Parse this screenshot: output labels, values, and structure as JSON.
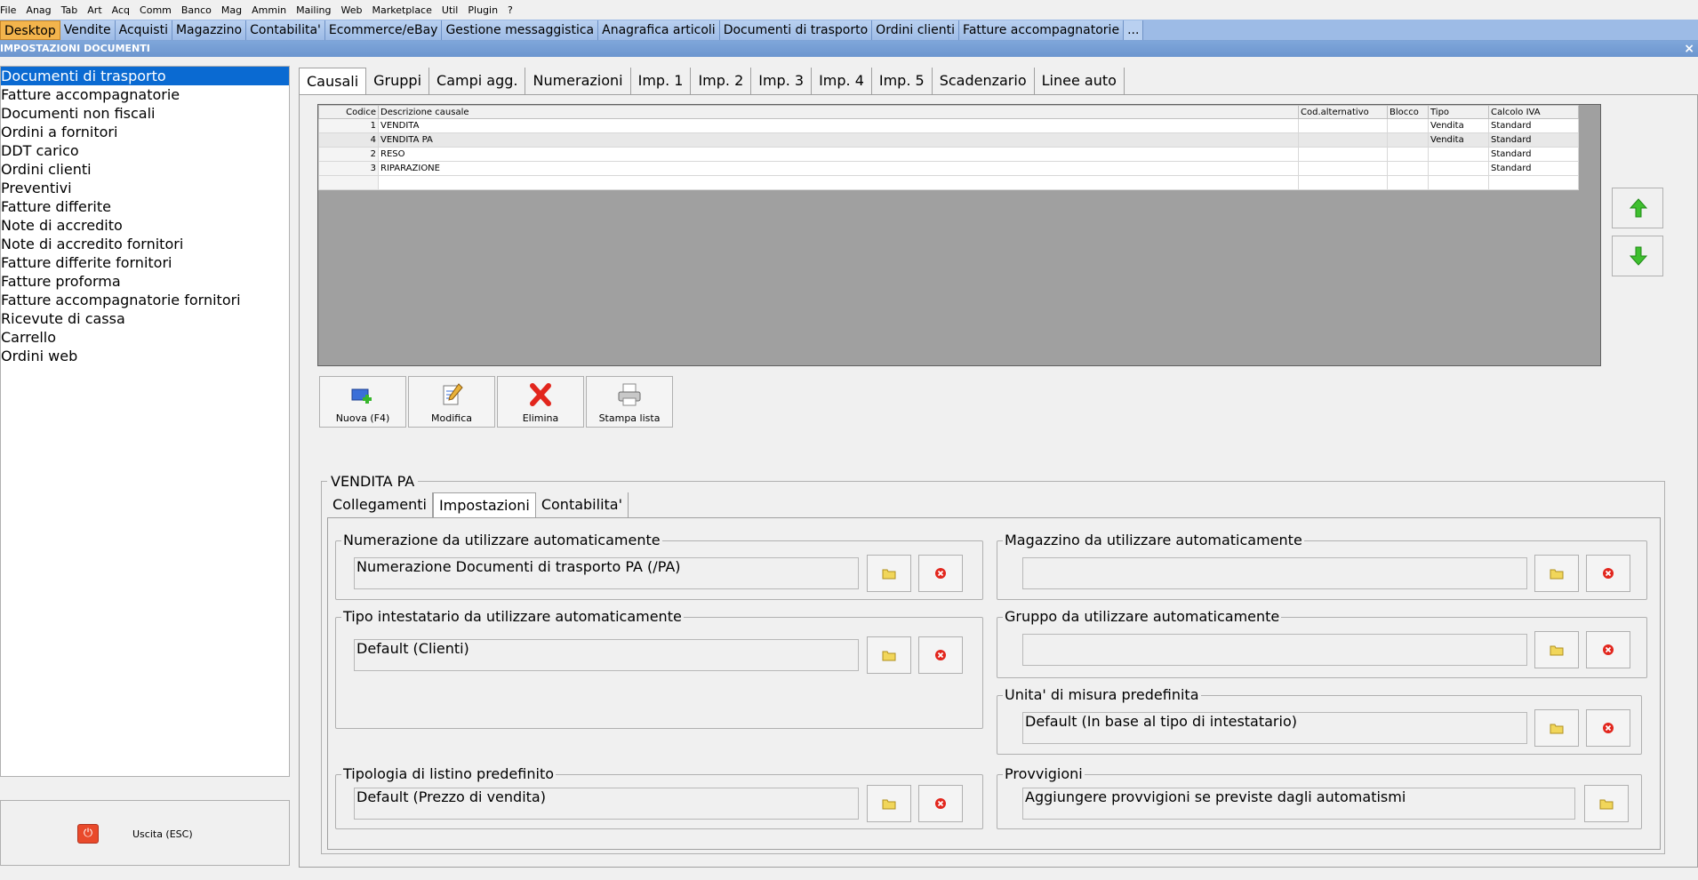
{
  "menu": [
    "File",
    "Anag",
    "Tab",
    "Art",
    "Acq",
    "Comm",
    "Banco",
    "Mag",
    "Ammin",
    "Mailing",
    "Web",
    "Marketplace",
    "Util",
    "Plugin",
    "?"
  ],
  "app_tabs": [
    "Desktop",
    "Vendite",
    "Acquisti",
    "Magazzino",
    "Contabilita'",
    "Ecommerce/eBay",
    "Gestione messaggistica",
    "Anagrafica articoli",
    "Documenti di trasporto",
    "Ordini clienti",
    "Fatture accompagnatorie",
    "..."
  ],
  "window_title": "IMPOSTAZIONI DOCUMENTI",
  "window_close": "×",
  "document_types": [
    "Documenti di trasporto",
    "Fatture accompagnatorie",
    "Documenti non fiscali",
    "Ordini a fornitori",
    "DDT carico",
    "Ordini clienti",
    "Preventivi",
    "Fatture differite",
    "Note di accredito",
    "Note di accredito fornitori",
    "Fatture differite fornitori",
    "Fatture proforma",
    "Fatture accompagnatorie fornitori",
    "Ricevute di cassa",
    "Carrello",
    "Ordini web"
  ],
  "exit": {
    "label": "Uscita (ESC)"
  },
  "sub_tabs": [
    "Causali",
    "Gruppi",
    "Campi agg.",
    "Numerazioni",
    "Imp. 1",
    "Imp. 2",
    "Imp. 3",
    "Imp. 4",
    "Imp. 5",
    "Scadenzario",
    "Linee auto"
  ],
  "grid": {
    "headers": [
      "Codice",
      "Descrizione causale",
      "Cod.alternativo",
      "Blocco",
      "Tipo",
      "Calcolo IVA"
    ],
    "rows": [
      [
        "1",
        "VENDITA",
        "",
        "",
        "Vendita",
        "Standard"
      ],
      [
        "4",
        "VENDITA PA",
        "",
        "",
        "Vendita",
        "Standard"
      ],
      [
        "2",
        "RESO",
        "",
        "",
        "",
        "Standard"
      ],
      [
        "3",
        "RIPARAZIONE",
        "",
        "",
        "",
        "Standard"
      ]
    ]
  },
  "toolbar": {
    "new": "Nuova (F4)",
    "edit": "Modifica",
    "delete": "Elimina",
    "print": "Stampa lista"
  },
  "detail": {
    "title": "VENDITA PA",
    "tabs": [
      "Collegamenti",
      "Impostazioni",
      "Contabilita'"
    ],
    "fields": {
      "numerazione": {
        "label": "Numerazione da utilizzare automaticamente",
        "value": "Numerazione Documenti di trasporto PA (/PA)"
      },
      "magazzino": {
        "label": "Magazzino da utilizzare automaticamente",
        "value": ""
      },
      "tipo_intestatario": {
        "label": "Tipo intestatario da utilizzare automaticamente",
        "value": "Default (Clienti)"
      },
      "gruppo": {
        "label": "Gruppo da utilizzare automaticamente",
        "value": ""
      },
      "unita_misura": {
        "label": "Unita' di misura predefinita",
        "value": "Default (In base al tipo di intestatario)"
      },
      "listino": {
        "label": "Tipologia di listino predefinito",
        "value": "Default (Prezzo di vendita)"
      },
      "provvigioni": {
        "label": "Provvigioni",
        "value": "Aggiungere provvigioni se previste dagli automatismi"
      }
    }
  },
  "colors": {
    "selection": "#0a6ad2",
    "active_tab": "#f3b44c",
    "tabbar": "#9dbbe6",
    "title_bar": "#6c96cf"
  }
}
